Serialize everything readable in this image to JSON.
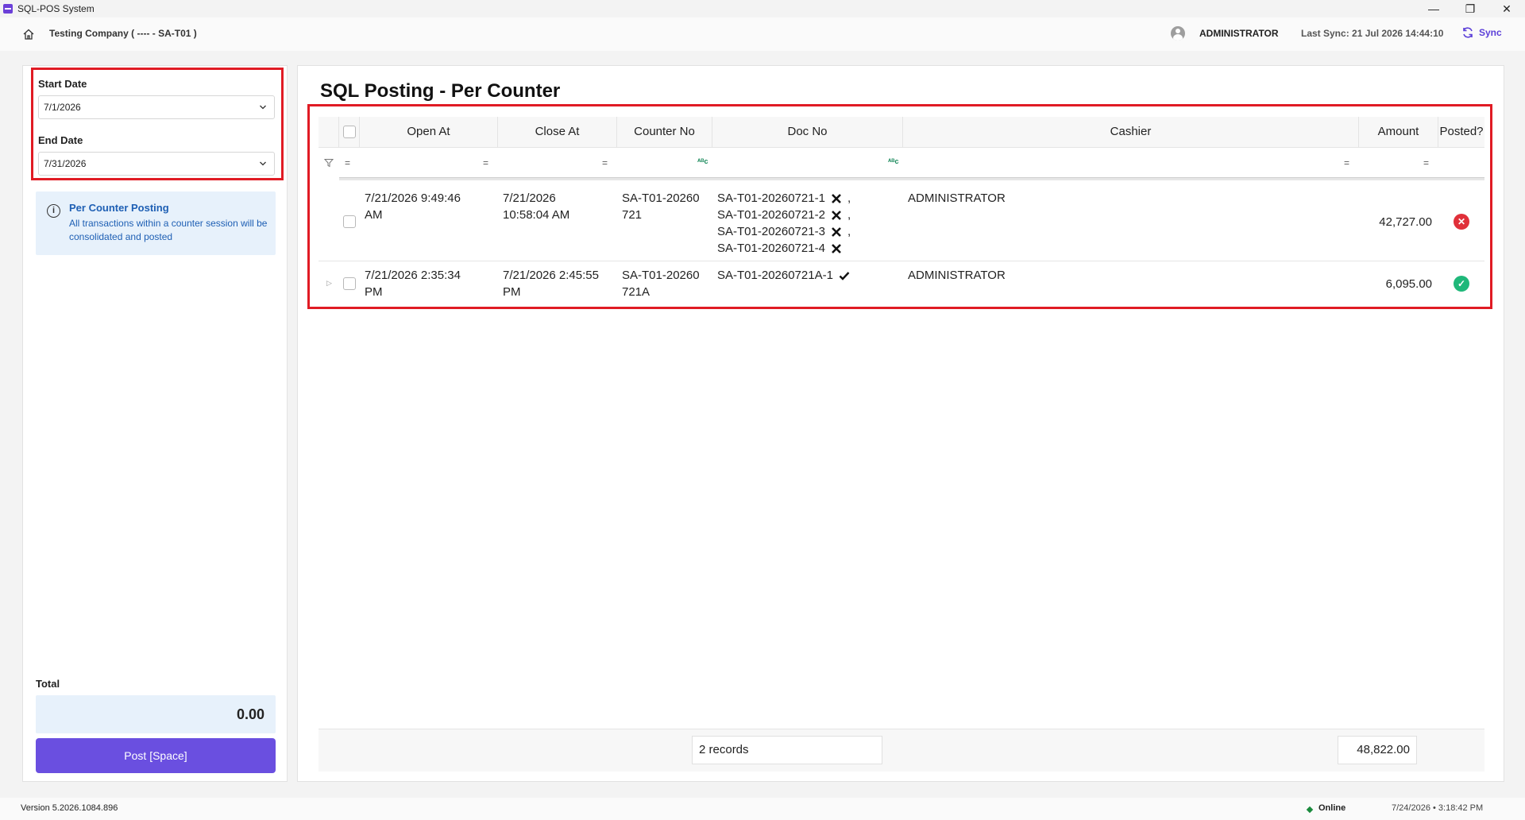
{
  "window": {
    "title": "SQL-POS System",
    "controls": {
      "minimize": "—",
      "restore": "❐",
      "close": "✕"
    }
  },
  "header": {
    "company": "Testing Company ( ---- - SA-T01 )",
    "user": "ADMINISTRATOR",
    "last_sync": "Last Sync: 21 Jul 2026 14:44:10",
    "sync_label": "Sync",
    "accent": "#5b3fd8"
  },
  "filters": {
    "start_label": "Start Date",
    "start_value": "7/1/2026",
    "end_label": "End Date",
    "end_value": "7/31/2026"
  },
  "info": {
    "title": "Per Counter Posting",
    "text": "All transactions within a counter session will be consolidated and posted"
  },
  "totals": {
    "label": "Total",
    "value": "0.00",
    "post_button": "Post [Space]"
  },
  "main": {
    "title": "SQL Posting - Per Counter",
    "columns": {
      "open_at": "Open At",
      "close_at": "Close At",
      "counter_no": "Counter No",
      "doc_no": "Doc No",
      "cashier": "Cashier",
      "amount": "Amount",
      "posted": "Posted?"
    },
    "filter_symbol": "=",
    "abc_symbol": "ᴬᴮc",
    "rows": [
      {
        "open_at_1": "7/21/2026 9:49:46",
        "open_at_2": "AM",
        "close_at_1": "7/21/2026",
        "close_at_2": "10:58:04 AM",
        "counter_1": "SA-T01-20260",
        "counter_2": "721",
        "docs": [
          {
            "no": "SA-T01-20260721-1",
            "status": "x",
            "sep": ","
          },
          {
            "no": "SA-T01-20260721-2",
            "status": "x",
            "sep": ","
          },
          {
            "no": "SA-T01-20260721-3",
            "status": "x",
            "sep": ","
          },
          {
            "no": "SA-T01-20260721-4",
            "status": "x",
            "sep": ""
          }
        ],
        "cashier": "ADMINISTRATOR",
        "amount": "42,727.00",
        "posted": false
      },
      {
        "open_at_1": "7/21/2026 2:35:34",
        "open_at_2": "PM",
        "close_at_1": "7/21/2026 2:45:55",
        "close_at_2": "PM",
        "counter_1": "SA-T01-20260",
        "counter_2": "721A",
        "docs": [
          {
            "no": "SA-T01-20260721A-1",
            "status": "check",
            "sep": ""
          }
        ],
        "cashier": "ADMINISTRATOR",
        "amount": "6,095.00",
        "posted": true
      }
    ],
    "footer": {
      "records": "2 records",
      "sum": "48,822.00"
    },
    "status_colors": {
      "not_posted": "#e0303a",
      "posted": "#1fb87a"
    }
  },
  "statusbar": {
    "version": "Version 5.2026.1084.896",
    "online": "Online",
    "datetime": "7/24/2026 • 3:18:42 PM"
  }
}
